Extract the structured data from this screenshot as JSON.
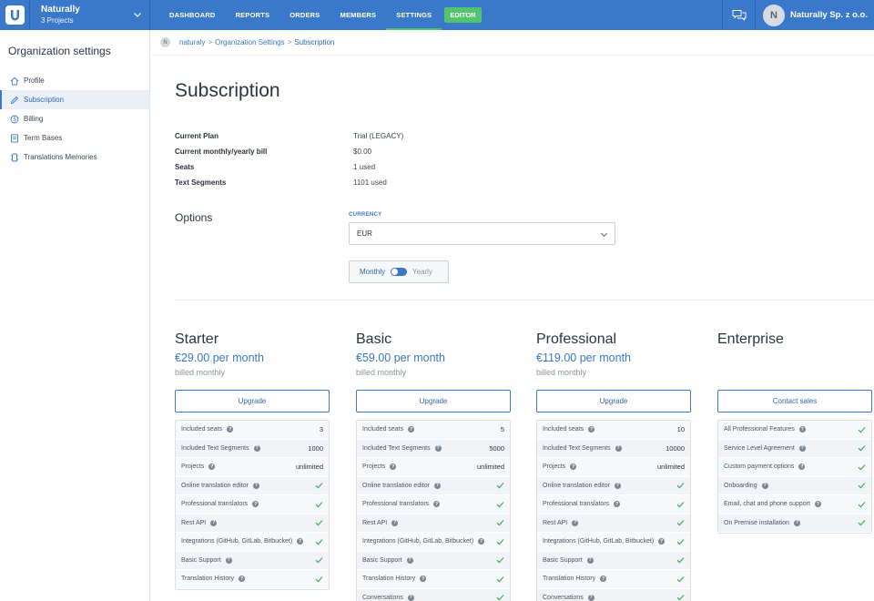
{
  "topbar": {
    "project_name": "Naturally",
    "project_count": "3 Projects",
    "nav": [
      "DASHBOARD",
      "REPORTS",
      "ORDERS",
      "MEMBERS",
      "SETTINGS"
    ],
    "editor_label": "EDITOR",
    "account_initial": "N",
    "account_name": "Naturally Sp. z o.o.",
    "accent": "#3a78c9",
    "editor_color": "#53c46d"
  },
  "sidebar": {
    "title": "Organization settings",
    "items": [
      {
        "label": "Profile",
        "icon": "home-icon"
      },
      {
        "label": "Subscription",
        "icon": "pen-icon"
      },
      {
        "label": "Billing",
        "icon": "dollar-icon"
      },
      {
        "label": "Term Bases",
        "icon": "book-icon"
      },
      {
        "label": "Translations Memories",
        "icon": "memory-icon"
      }
    ]
  },
  "breadcrumb": {
    "badge": "N",
    "items": [
      "naturaly",
      "Organization Settings",
      "Subscription"
    ],
    "sep": ">"
  },
  "main": {
    "title": "Subscription",
    "info": [
      {
        "label": "Current Plan",
        "value": "Trial (LEGACY)"
      },
      {
        "label": "Current monthly/yearly bill",
        "value": "$0.00"
      },
      {
        "label": "Seats",
        "value": "1 used"
      },
      {
        "label": "Text Segments",
        "value": "1101 used"
      }
    ],
    "options_title": "Options",
    "currency_label": "CURRENCY",
    "currency_value": "EUR",
    "toggle_monthly": "Monthly",
    "toggle_yearly": "Yearly"
  },
  "plans": [
    {
      "name": "Starter",
      "price": "€29.00 per month",
      "billed": "billed monthly",
      "button": "Upgrade",
      "features": [
        {
          "label": "Included seats",
          "value": "3"
        },
        {
          "label": "Included Text Segments",
          "value": "1000"
        },
        {
          "label": "Projects",
          "value": "unlimited"
        },
        {
          "label": "Online translation editor",
          "value": "check"
        },
        {
          "label": "Professional translators",
          "value": "check"
        },
        {
          "label": "Rest API",
          "value": "check"
        },
        {
          "label": "Integrations (GitHub, GitLab, Bitbucket)",
          "value": "check"
        },
        {
          "label": "Basic Support",
          "value": "check"
        },
        {
          "label": "Translation History",
          "value": "check"
        }
      ]
    },
    {
      "name": "Basic",
      "price": "€59.00 per month",
      "billed": "billed monthly",
      "button": "Upgrade",
      "features": [
        {
          "label": "Included seats",
          "value": "5"
        },
        {
          "label": "Included Text Segments",
          "value": "5000"
        },
        {
          "label": "Projects",
          "value": "unlimited"
        },
        {
          "label": "Online translation editor",
          "value": "check"
        },
        {
          "label": "Professional translators",
          "value": "check"
        },
        {
          "label": "Rest API",
          "value": "check"
        },
        {
          "label": "Integrations (GitHub, GitLab, Bitbucket)",
          "value": "check"
        },
        {
          "label": "Basic Support",
          "value": "check"
        },
        {
          "label": "Translation History",
          "value": "check"
        },
        {
          "label": "Conversations",
          "value": "check"
        }
      ]
    },
    {
      "name": "Professional",
      "price": "€119.00 per month",
      "billed": "billed monthly",
      "button": "Upgrade",
      "features": [
        {
          "label": "Included seats",
          "value": "10"
        },
        {
          "label": "Included Text Segments",
          "value": "10000"
        },
        {
          "label": "Projects",
          "value": "unlimited"
        },
        {
          "label": "Online translation editor",
          "value": "check"
        },
        {
          "label": "Professional translators",
          "value": "check"
        },
        {
          "label": "Rest API",
          "value": "check"
        },
        {
          "label": "Integrations (GitHub, GitLab, Bitbucket)",
          "value": "check"
        },
        {
          "label": "Basic Support",
          "value": "check"
        },
        {
          "label": "Translation History",
          "value": "check"
        },
        {
          "label": "Conversations",
          "value": "check"
        }
      ]
    },
    {
      "name": "Enterprise",
      "price": "",
      "billed": "",
      "button": "Contact sales",
      "features": [
        {
          "label": "All Professional Features",
          "value": "check"
        },
        {
          "label": "Service Level Agreement",
          "value": "check"
        },
        {
          "label": "Custom payment options",
          "value": "check"
        },
        {
          "label": "Onboarding",
          "value": "check"
        },
        {
          "label": "Email, chat and phone support",
          "value": "check"
        },
        {
          "label": "On Premise installation",
          "value": "check"
        }
      ]
    }
  ]
}
